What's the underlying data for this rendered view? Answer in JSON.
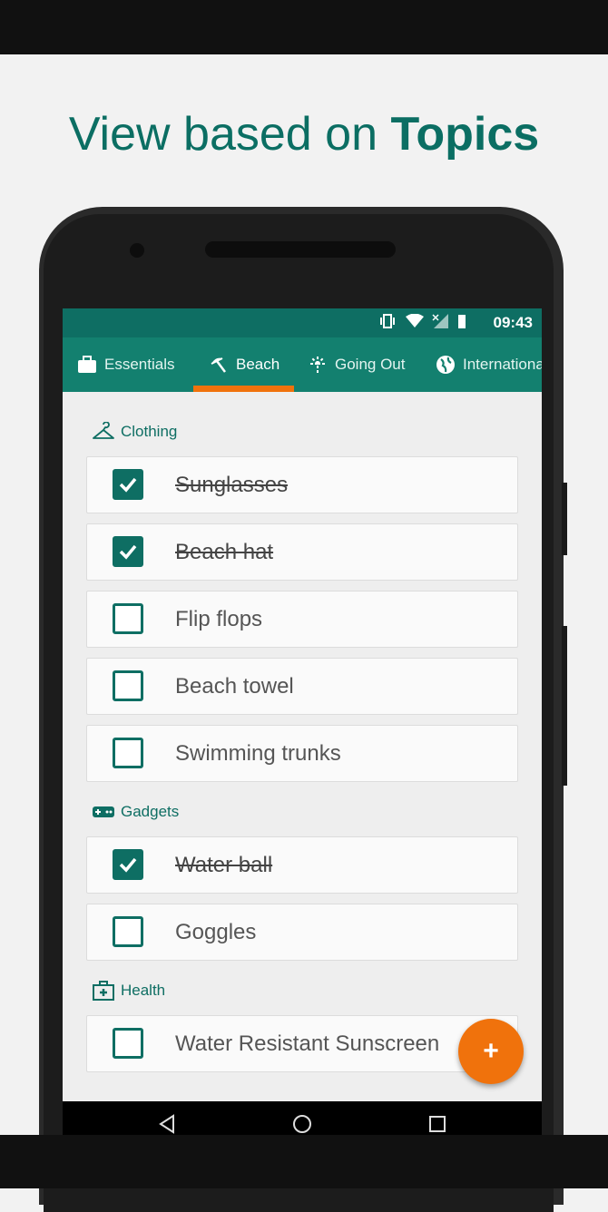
{
  "headline": {
    "normal": "View based on ",
    "bold": "Topics"
  },
  "status_bar": {
    "time": "09:43",
    "icons": [
      "vibrate-icon",
      "wifi-icon",
      "signal-icon",
      "battery-icon"
    ]
  },
  "tabs": [
    {
      "label": "Essentials",
      "icon": "briefcase-icon",
      "active": false
    },
    {
      "label": "Beach",
      "icon": "beach-umbrella-icon",
      "active": true
    },
    {
      "label": "Going Out",
      "icon": "fireworks-icon",
      "active": false
    },
    {
      "label": "International",
      "icon": "globe-icon",
      "active": false
    }
  ],
  "sections": [
    {
      "title": "Clothing",
      "icon": "hanger-icon",
      "items": [
        {
          "label": "Sunglasses",
          "checked": true
        },
        {
          "label": "Beach hat",
          "checked": true
        },
        {
          "label": "Flip flops",
          "checked": false
        },
        {
          "label": "Beach towel",
          "checked": false
        },
        {
          "label": "Swimming trunks",
          "checked": false
        }
      ]
    },
    {
      "title": "Gadgets",
      "icon": "gamepad-icon",
      "items": [
        {
          "label": "Water ball",
          "checked": true
        },
        {
          "label": "Goggles",
          "checked": false
        }
      ]
    },
    {
      "title": "Health",
      "icon": "first-aid-kit-icon",
      "items": [
        {
          "label": "Water Resistant Sunscreen",
          "checked": false
        }
      ]
    }
  ],
  "fab": {
    "label": "+"
  },
  "colors": {
    "primary": "#13806f",
    "dark": "#0e6e63",
    "accent": "#f0720c"
  }
}
